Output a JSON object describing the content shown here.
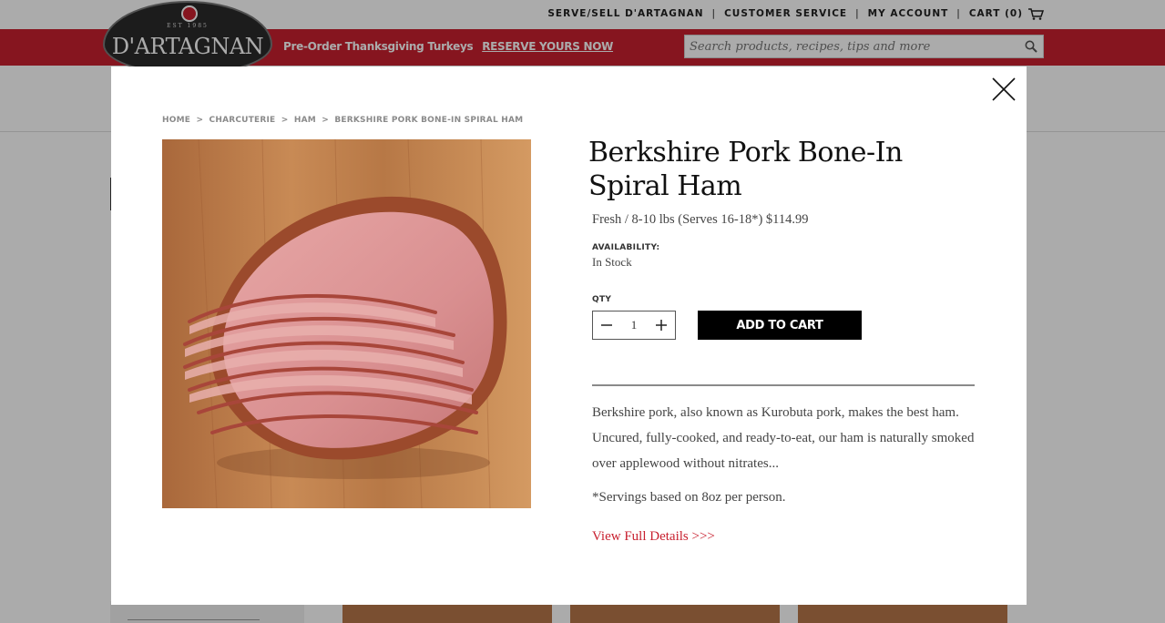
{
  "header": {
    "links": [
      "SERVE/SELL D'ARTAGNAN",
      "CUSTOMER SERVICE",
      "MY ACCOUNT",
      "CART (0)"
    ],
    "separator": "|",
    "logo_est": "EST 1985",
    "logo_text": "D'ARTAGNAN",
    "promo_text": "Pre-Order Thanksgiving Turkeys",
    "promo_link": "RESERVE YOURS NOW",
    "search_placeholder": "Search products, recipes, tips and more"
  },
  "modal": {
    "breadcrumb": [
      "HOME",
      "CHARCUTERIE",
      "HAM",
      "BERKSHIRE PORK BONE-IN SPIRAL HAM"
    ],
    "breadcrumb_sep": ">",
    "title": "Berkshire Pork Bone-In Spiral Ham",
    "variant": "Fresh / 8-10 lbs (Serves 16-18*) $114.99",
    "availability_label": "AVAILABILITY:",
    "availability_value": "In Stock",
    "qty_label": "QTY",
    "qty_value": "1",
    "add_to_cart": "ADD TO CART",
    "description": "Berkshire pork, also known as Kurobuta pork, makes the best ham. Uncured, fully-cooked, and ready-to-eat, our ham is naturally smoked over applewood without nitrates...",
    "servings_note": "*Servings based on 8oz per person.",
    "details_link": "View Full Details >>>"
  },
  "colors": {
    "brand_red": "#c8202f",
    "button_black": "#000000"
  },
  "icons": [
    "cart-icon",
    "search-icon",
    "close-icon",
    "minus-icon",
    "plus-icon"
  ]
}
